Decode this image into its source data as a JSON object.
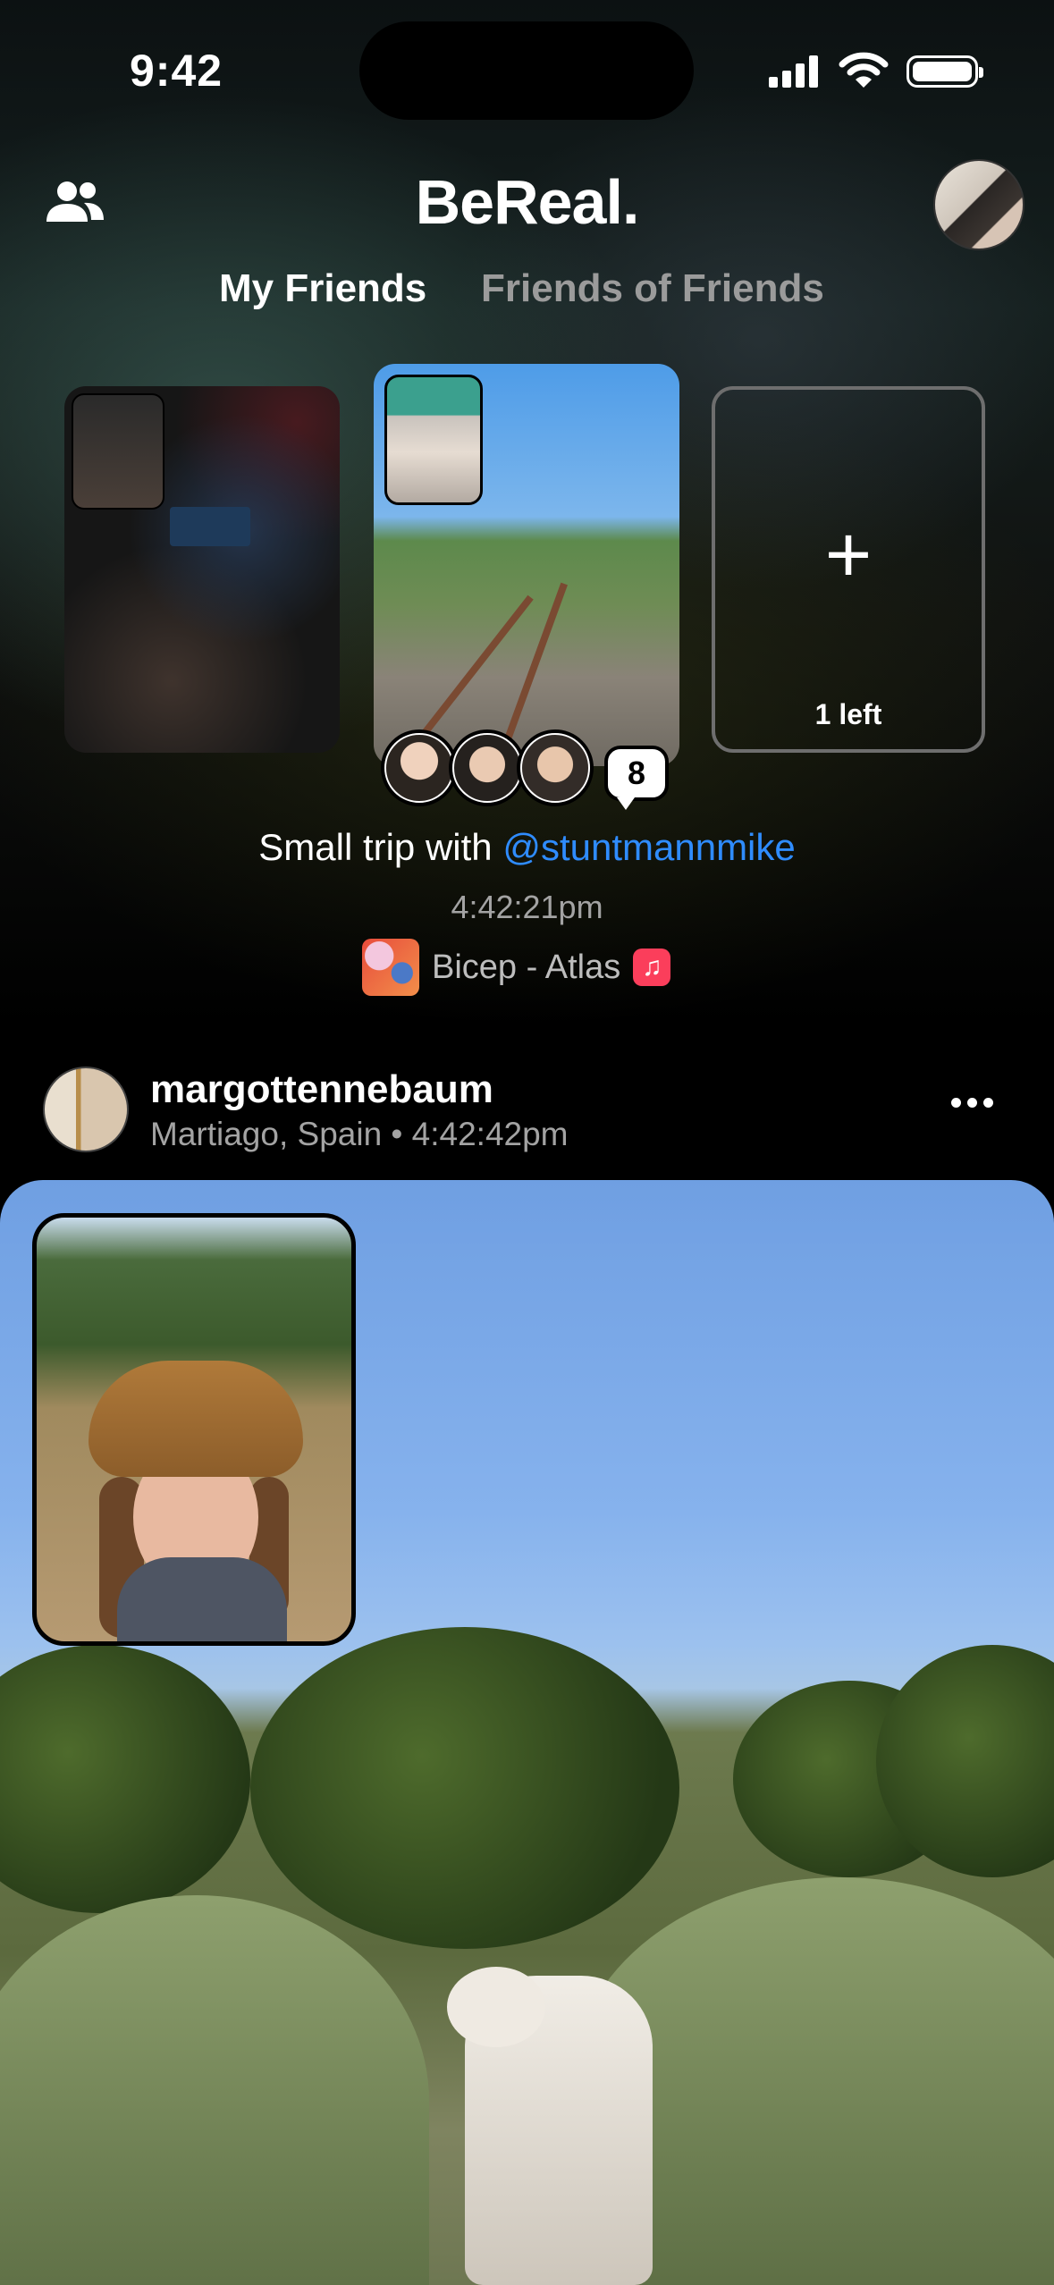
{
  "status_bar": {
    "time": "9:42"
  },
  "header": {
    "title": "BeReal.",
    "tabs": [
      {
        "label": "My Friends",
        "active": true
      },
      {
        "label": "Friends of Friends",
        "active": false
      }
    ]
  },
  "my_bereal": {
    "remaining_label": "1 left",
    "reaction_count": "8",
    "caption_prefix": "Small trip with ",
    "caption_mention": "@stuntmannmike",
    "time": "4:42:21pm",
    "music": "Bicep - Atlas"
  },
  "post": {
    "username": "margottennebaum",
    "location_time": "Martiago, Spain • 4:42:42pm"
  },
  "colors": {
    "accent_blue": "#2f8cff",
    "secondary_text": "#a3a3a3",
    "apple_music_red": "#fb3e5b"
  }
}
